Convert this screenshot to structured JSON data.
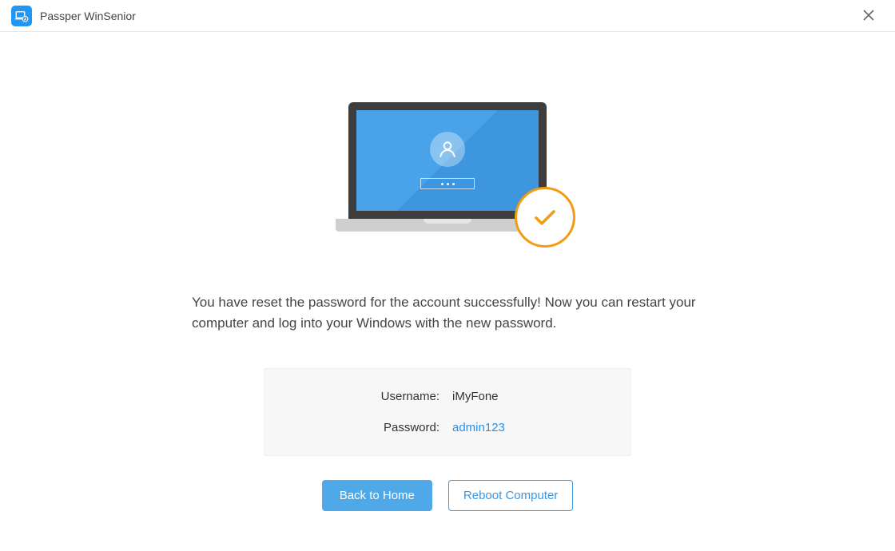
{
  "titlebar": {
    "app_name": "Passper WinSenior"
  },
  "main": {
    "message": "You have reset the password for the account successfully! Now you can restart your computer and log into your Windows with the new password.",
    "info": {
      "username_label": "Username:",
      "username_value": "iMyFone",
      "password_label": "Password:",
      "password_value": "admin123"
    },
    "buttons": {
      "back_home": "Back to Home",
      "reboot": "Reboot Computer"
    }
  },
  "colors": {
    "primary": "#4fa8e8",
    "accent": "#f39c12",
    "link": "#2b90e6"
  }
}
